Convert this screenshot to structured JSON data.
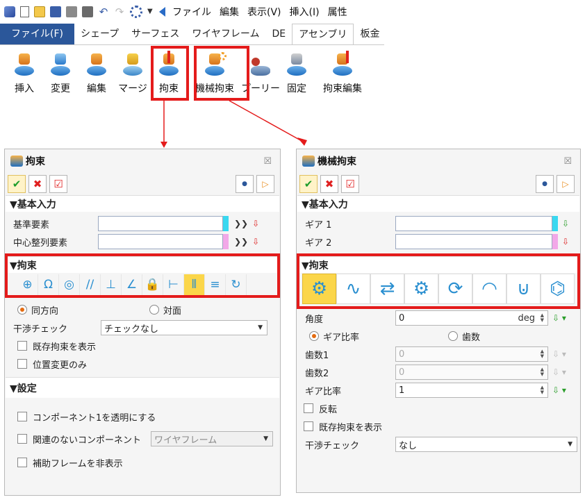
{
  "menu": [
    "ファイル",
    "編集",
    "表示(V)",
    "挿入(I)",
    "属性"
  ],
  "tabs": [
    "ファイル(F)",
    "シェープ",
    "サーフェス",
    "ワイヤフレーム",
    "DE",
    "アセンブリ",
    "板金"
  ],
  "ribbon": [
    "挿入",
    "変更",
    "編集",
    "マージ",
    "拘束",
    "機械拘束",
    "プーリー",
    "固定",
    "拘束編集"
  ],
  "left": {
    "title": "拘束",
    "close": "☒",
    "basic_section": "▼基本入力",
    "ref_label": "基準要素",
    "center_label": "中心整列要素",
    "constraint_section": "▼拘束",
    "constraint_icons": [
      "⊕",
      "Ω",
      "◎",
      "//",
      "⊥",
      "∠",
      "🔒",
      "⊢",
      "⫴",
      "≡",
      "↻"
    ],
    "same_dir": "同方向",
    "opposite": "対面",
    "interference_label": "干渉チェック",
    "interference_value": "チェックなし",
    "show_existing": "既存拘束を表示",
    "position_only": "位置変更のみ",
    "settings_section": "▼設定",
    "transparent": "コンポーネント1を透明にする",
    "unrelated": "関連のないコンポーネント",
    "unrelated_value": "ワイヤフレーム",
    "hide_frame": "補助フレームを非表示"
  },
  "right": {
    "title": "機械拘束",
    "close": "☒",
    "basic_section": "▼基本入力",
    "gear1": "ギア 1",
    "gear2": "ギア 2",
    "constraint_section": "▼拘束",
    "mech_icons": [
      "⚙",
      "∿",
      "⇄",
      "⚙",
      "⟳",
      "◠",
      "⊍",
      "⌬"
    ],
    "angle_label": "角度",
    "angle_value": "0",
    "angle_unit": "deg",
    "gear_ratio_radio": "ギア比率",
    "teeth_radio": "歯数",
    "teeth1_label": "歯数1",
    "teeth1_value": "0",
    "teeth2_label": "歯数2",
    "teeth2_value": "0",
    "ratio_label": "ギア比率",
    "ratio_value": "1",
    "reverse": "反転",
    "show_existing": "既存拘束を表示",
    "interference_label": "干渉チェック",
    "interference_value": "なし"
  },
  "colors": {
    "accent": "#2b579a",
    "highlight": "#e41b1b",
    "selected": "#fbd64a",
    "ref_strip": "#39d8f0",
    "center_strip": "#f2a8e8",
    "gear_strip": "#39d8f0"
  }
}
